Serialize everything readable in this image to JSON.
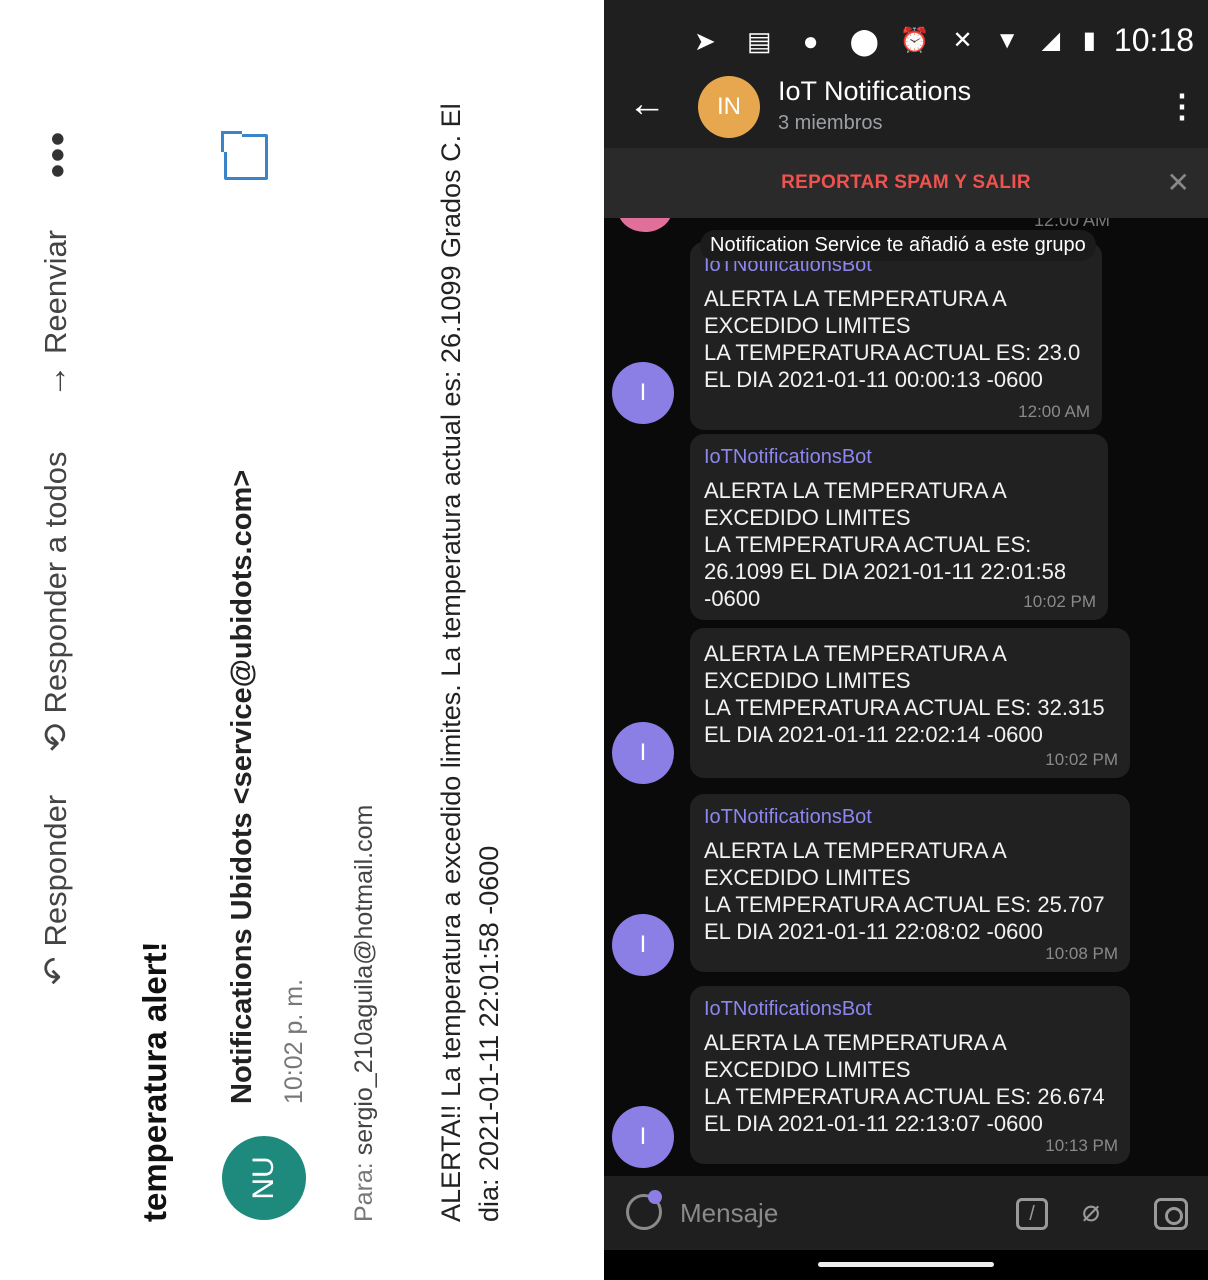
{
  "email": {
    "actions": {
      "reply": "Responder",
      "reply_all": "Responder a todos",
      "forward": "Reenviar"
    },
    "more_icon": "more-vertical-icon",
    "subject": "temperatura alert!",
    "avatar_initials": "NU",
    "avatar_color": "#1e8a7e",
    "sender": "Notifications Ubidots <service@ubidots.com>",
    "time": "10:02 p. m.",
    "to_label": "Para:",
    "to_address": "sergio_210aguila@hotmail.com",
    "body_line1": "ALERTA!! La temperatura a excedido limites. La temperatura actual es: 26.1099 Grados C. El",
    "body_line2": "dia: 2021-01-11 22:01:58 -0600"
  },
  "statusbar": {
    "icons_left": "➤ ▤ ● ⬤ •",
    "icons_right": "⏰ ✕ ▼ ◢ ▮",
    "time": "10:18"
  },
  "header": {
    "avatar_initials": "IN",
    "avatar_color": "#e6a74e",
    "title": "IoT Notifications",
    "subtitle": "3 miembros"
  },
  "spam_bar": {
    "label": "REPORTAR SPAM Y SALIR"
  },
  "chat": {
    "cut_time": "12:00 AM",
    "system_message": "Notification Service te añadió a este grupo",
    "avatar_letter": "I",
    "messages": [
      {
        "sender": "IoTNotificationsBot",
        "lines": [
          "ALERTA LA TEMPERATURA A",
          "EXCEDIDO LIMITES",
          "LA TEMPERATURA ACTUAL ES: 23.0",
          "EL DIA 2021-01-11 00:00:13 -0600"
        ],
        "time": "12:00 AM"
      },
      {
        "sender": "IoTNotificationsBot",
        "lines": [
          "ALERTA LA TEMPERATURA A",
          "EXCEDIDO LIMITES",
          "LA TEMPERATURA ACTUAL ES:",
          "26.1099 EL DIA 2021-01-11 22:01:58",
          "-0600"
        ],
        "time": "10:02 PM"
      },
      {
        "sender": "",
        "lines": [
          "ALERTA LA TEMPERATURA A",
          "EXCEDIDO LIMITES",
          "LA TEMPERATURA ACTUAL ES: 32.315",
          "EL DIA 2021-01-11 22:02:14 -0600"
        ],
        "time": "10:02 PM"
      },
      {
        "sender": "IoTNotificationsBot",
        "lines": [
          "ALERTA LA TEMPERATURA A",
          "EXCEDIDO LIMITES",
          "LA TEMPERATURA ACTUAL ES: 25.707",
          "EL DIA 2021-01-11 22:08:02 -0600"
        ],
        "time": "10:08 PM"
      },
      {
        "sender": "IoTNotificationsBot",
        "lines": [
          "ALERTA LA TEMPERATURA A",
          "EXCEDIDO LIMITES",
          "LA TEMPERATURA ACTUAL ES: 26.674",
          "EL DIA 2021-01-11 22:13:07 -0600"
        ],
        "time": "10:13 PM"
      }
    ]
  },
  "input": {
    "placeholder": "Mensaje"
  },
  "colors": {
    "accent_purple": "#8b7fe6",
    "sender_name": "#8e86ef",
    "spam_red": "#ef5350",
    "bubble": "#212121"
  }
}
